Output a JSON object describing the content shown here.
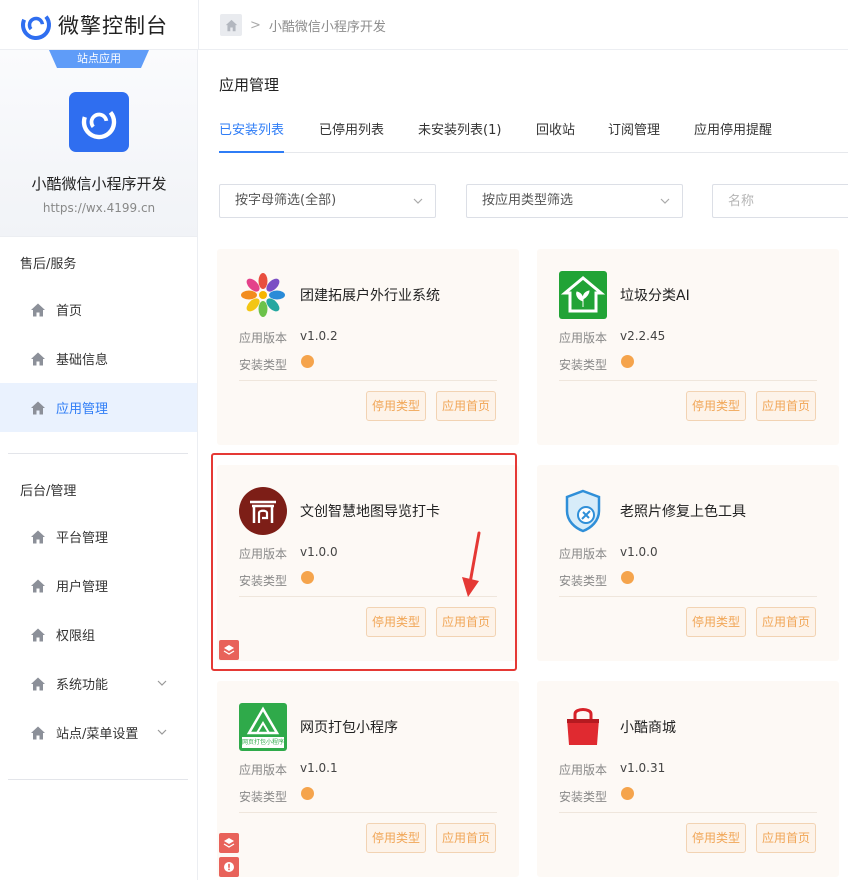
{
  "header": {
    "brand_name": "微擎控制台",
    "breadcrumb_current": "小酷微信小程序开发",
    "breadcrumb_sep": ">"
  },
  "sidebar": {
    "ribbon": "站点应用",
    "site_name": "小酷微信小程序开发",
    "site_url": "https://wx.4199.cn",
    "groups": [
      {
        "title": "售后/服务",
        "items": [
          {
            "label": "首页"
          },
          {
            "label": "基础信息"
          },
          {
            "label": "应用管理",
            "active": true
          }
        ]
      },
      {
        "title": "后台/管理",
        "items": [
          {
            "label": "平台管理"
          },
          {
            "label": "用户管理"
          },
          {
            "label": "权限组"
          },
          {
            "label": "系统功能",
            "has_submenu": true
          },
          {
            "label": "站点/菜单设置",
            "has_submenu": true
          }
        ]
      }
    ]
  },
  "main": {
    "page_title": "应用管理",
    "tabs": [
      {
        "label": "已安装列表",
        "active": true
      },
      {
        "label": "已停用列表"
      },
      {
        "label": "未安装列表(1)"
      },
      {
        "label": "回收站"
      },
      {
        "label": "订阅管理"
      },
      {
        "label": "应用停用提醒"
      }
    ],
    "filters": {
      "letter_filter": "按字母筛选(全部)",
      "type_filter": "按应用类型筛选",
      "name_placeholder": "名称"
    },
    "labels": {
      "version": "应用版本",
      "install_type": "安装类型",
      "disable_btn": "停用类型",
      "home_btn": "应用首页"
    },
    "apps": [
      {
        "title": "团建拓展户外行业系统",
        "version": "v1.0.2",
        "icon": "team-flower-icon"
      },
      {
        "title": "垃圾分类AI",
        "version": "v2.2.45",
        "icon": "green-house-icon"
      },
      {
        "title": "文创智慧地图导览打卡",
        "version": "v1.0.0",
        "icon": "gate-icon"
      },
      {
        "title": "老照片修复上色工具",
        "version": "v1.0.0",
        "icon": "shield-wrench-icon"
      },
      {
        "title": "网页打包小程序",
        "version": "v1.0.1",
        "icon": "webpage-pack-icon",
        "icon_text": "网页打包小程序"
      },
      {
        "title": "小酷商城",
        "version": "v1.0.31",
        "icon": "shopping-bag-icon"
      }
    ]
  },
  "colors": {
    "accent": "#2f7df6",
    "brand_icon_bg": "#2f6ef0",
    "card_bg": "#fdf9f5",
    "btn_text": "#f1a657",
    "highlight": "#e53935",
    "corner_tag": "#e8625a"
  }
}
